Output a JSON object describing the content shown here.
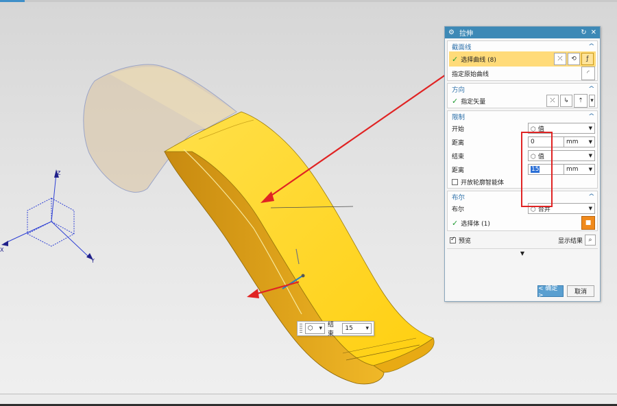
{
  "dialog": {
    "title": "拉伸",
    "sections": {
      "section_curve": {
        "header": "截面线",
        "select_curve_label": "选择曲线 (8)",
        "specify_origin_curve_label": "指定原始曲线"
      },
      "direction": {
        "header": "方向",
        "specify_vector_label": "指定矢量"
      },
      "limits": {
        "header": "限制",
        "start_label": "开始",
        "start_value": "值",
        "start_distance_label": "距离",
        "start_distance_value": "0",
        "end_label": "结束",
        "end_value": "值",
        "end_distance_label": "距离",
        "end_distance_value": "15",
        "unit": "mm",
        "open_profile_label": "开放轮廓智能体"
      },
      "boolean": {
        "header": "布尔",
        "boolean_label": "布尔",
        "boolean_value": "合并",
        "select_body_label": "选择体 (1)"
      }
    },
    "preview_label": "预览",
    "show_result_label": "显示结果",
    "ok_label": "< 确定 >",
    "cancel_label": "取消"
  },
  "mini_toolbar": {
    "end_label": "结束",
    "end_value": "15"
  },
  "axes": {
    "z": "Z",
    "y": "Y",
    "x": "X"
  },
  "colors": {
    "title_bar": "#3d89b6",
    "highlight_row": "#ffdb79",
    "section_header": "#2a6ea8",
    "annotation_red": "#e02323",
    "solid_yellow": "#ffd21c"
  }
}
